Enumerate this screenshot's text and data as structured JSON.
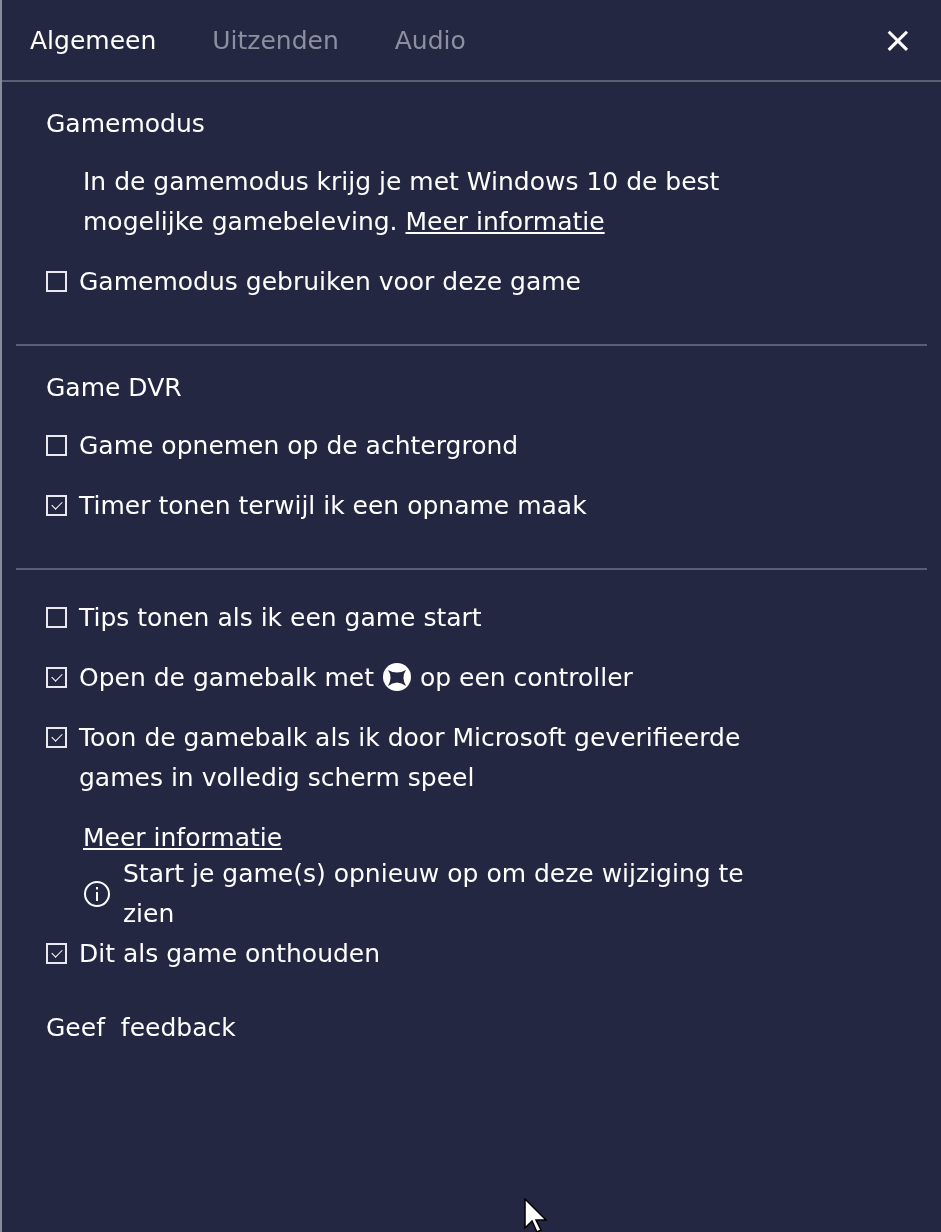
{
  "tabs": [
    {
      "label": "Algemeen",
      "selected": true
    },
    {
      "label": "Uitzenden",
      "selected": false
    },
    {
      "label": "Audio",
      "selected": false
    }
  ],
  "close": {
    "label": "×"
  },
  "sections": [
    {
      "heading": "Gamemodus",
      "description": {
        "text": "In de gamemodus krijg je met Windows 10 de best mogelijke gamebeleving.",
        "link": "Meer informatie"
      },
      "items": [
        {
          "kind": "checkbox",
          "label": "Gamemodus gebruiken voor deze game",
          "checked": false
        }
      ]
    },
    {
      "heading": "Game DVR",
      "items": [
        {
          "kind": "checkbox",
          "label": "Game opnemen op de achtergrond",
          "checked": false
        },
        {
          "kind": "checkbox",
          "label": "Timer tonen terwijl ik een opname maak",
          "checked": true
        }
      ]
    },
    {
      "items": [
        {
          "kind": "checkbox",
          "label": "Tips tonen als ik een game start",
          "checked": false
        },
        {
          "kind": "checkbox_icon",
          "label": "Open de gamebalk met",
          "after": "op een controller",
          "checked": true
        },
        {
          "kind": "checkbox",
          "label": "Toon de gamebalk als ik door Microsoft geverifieerde games in volledig scherm speel",
          "checked": true
        },
        {
          "kind": "link",
          "label": "Meer informatie"
        },
        {
          "kind": "info",
          "label": "Start je game(s) opnieuw op om deze wijziging te zien"
        },
        {
          "kind": "checkbox",
          "label": "Dit als game onthouden",
          "checked": true
        },
        {
          "kind": "plain_link",
          "label": "Geef  feedback"
        }
      ]
    }
  ]
}
